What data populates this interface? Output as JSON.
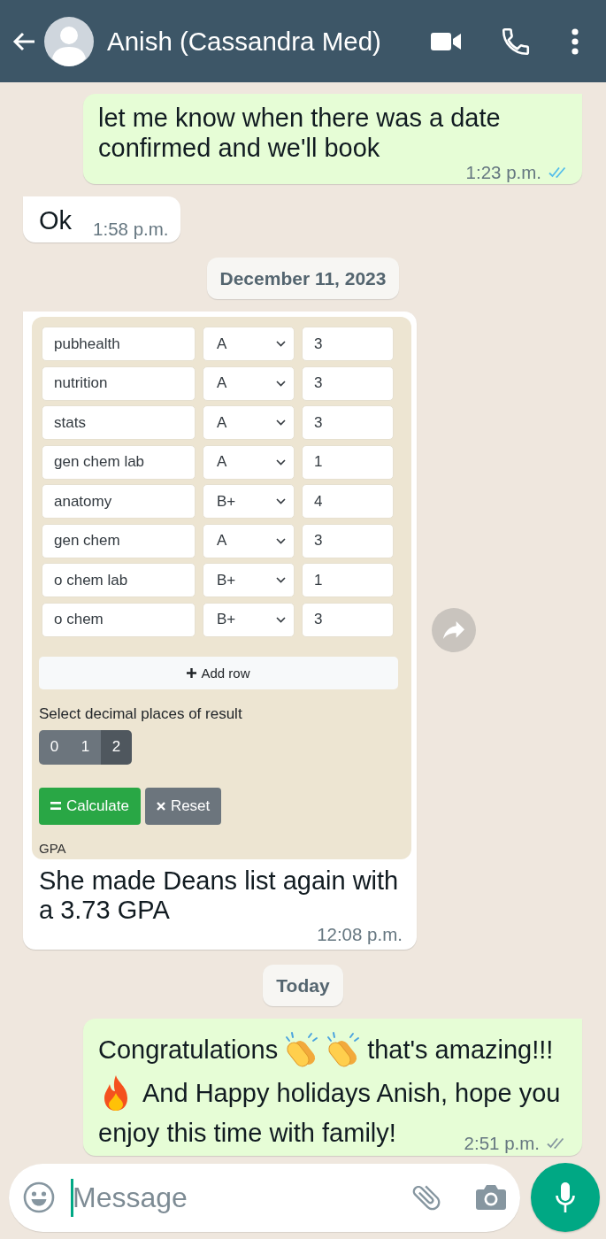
{
  "header": {
    "title": "Anish (Cassandra Med)"
  },
  "messages": [
    {
      "kind": "text",
      "outgoing": true,
      "text": "let me know when there was a date confirmed and we'll book",
      "time": "1:23 p.m.",
      "read": true
    },
    {
      "kind": "text",
      "outgoing": false,
      "text": "Ok",
      "time": "1:58 p.m."
    },
    {
      "kind": "date",
      "text": "December 11, 2023"
    },
    {
      "kind": "image",
      "outgoing": false,
      "screenshot": {
        "rows": [
          {
            "course": "pubhealth",
            "grade": "A",
            "credits": "3"
          },
          {
            "course": "nutrition",
            "grade": "A",
            "credits": "3"
          },
          {
            "course": "stats",
            "grade": "A",
            "credits": "3"
          },
          {
            "course": "gen chem lab",
            "grade": "A",
            "credits": "1"
          },
          {
            "course": "anatomy",
            "grade": "B+",
            "credits": "4"
          },
          {
            "course": "gen chem",
            "grade": "A",
            "credits": "3"
          },
          {
            "course": "o chem lab",
            "grade": "B+",
            "credits": "1"
          },
          {
            "course": "o chem",
            "grade": "B+",
            "credits": "3"
          }
        ],
        "add_row": "Add row",
        "decimal_label": "Select decimal places of result",
        "decimal_options": [
          {
            "label": "0",
            "selected": false
          },
          {
            "label": "1",
            "selected": false
          },
          {
            "label": "2",
            "selected": true
          }
        ],
        "buttons": [
          {
            "kind": "calculate",
            "label": "Calculate"
          },
          {
            "kind": "reset",
            "label": "Reset"
          }
        ],
        "result_label": "GPA"
      },
      "caption": "She made Deans list again with a 3.73 GPA",
      "time": "12:08 p.m."
    },
    {
      "kind": "date",
      "text": "Today"
    },
    {
      "kind": "rich",
      "outgoing": true,
      "parts": [
        {
          "kind": "text",
          "text": "Congratulations"
        },
        {
          "kind": "clap"
        },
        {
          "kind": "clap"
        },
        {
          "kind": "text",
          "text": "that's amazing!!!"
        },
        {
          "kind": "fire"
        },
        {
          "kind": "text",
          "text": "And Happy holidays Anish, hope you"
        },
        {
          "kind": "text",
          "text": "enjoy this time with family!"
        }
      ],
      "time": "2:51 p.m.",
      "read": false
    }
  ],
  "composer": {
    "placeholder": "Message"
  }
}
